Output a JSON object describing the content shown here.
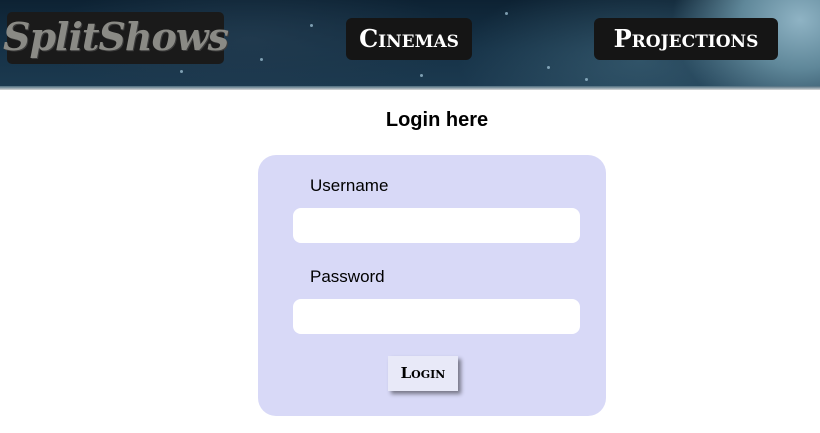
{
  "header": {
    "logo_text": "SplitShows",
    "nav": {
      "cinemas_label": "Cinemas",
      "projections_label": "Projections"
    }
  },
  "login": {
    "title": "Login here",
    "username_label": "Username",
    "username_value": "",
    "password_label": "Password",
    "password_value": "",
    "button_label": "Login"
  },
  "colors": {
    "panel_background": "#d8d9f7",
    "header_dark": "#0d2233",
    "nav_button_background": "#151515"
  }
}
